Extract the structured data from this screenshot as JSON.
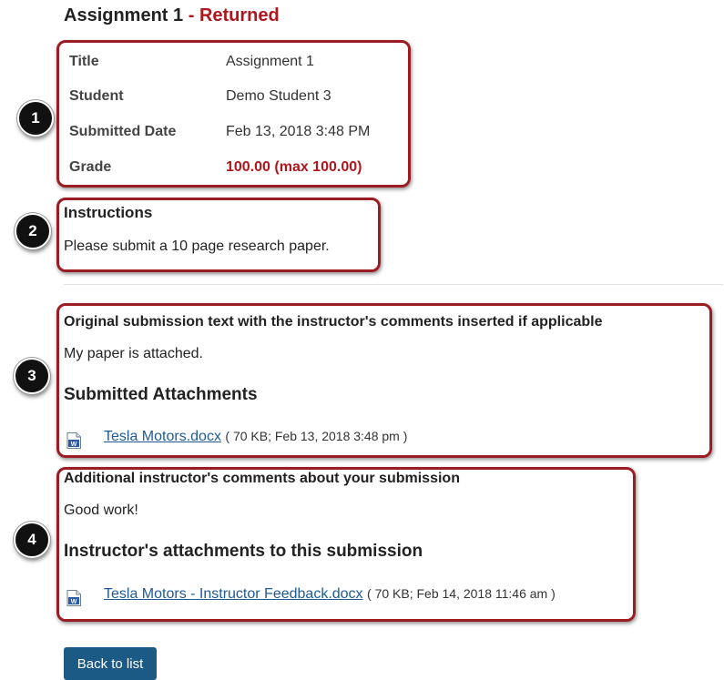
{
  "header": {
    "title": "Assignment 1",
    "separator": " - ",
    "status": "Returned"
  },
  "details": {
    "title_label": "Title",
    "title_value": "Assignment 1",
    "student_label": "Student",
    "student_value": "Demo Student 3",
    "submitted_label": "Submitted Date",
    "submitted_value": "Feb 13, 2018 3:48 PM",
    "grade_label": "Grade",
    "grade_value": "100.00 (max 100.00)"
  },
  "instructions": {
    "heading": "Instructions",
    "text": "Please submit a 10 page research paper."
  },
  "submission": {
    "heading": "Original submission text with the instructor's comments inserted if applicable",
    "text": "My paper is attached.",
    "attachments_heading": "Submitted Attachments",
    "file_name": "Tesla Motors.docx",
    "file_meta": "( 70 KB; Feb 13, 2018 3:48 pm )"
  },
  "feedback": {
    "heading": "Additional instructor's comments about your submission",
    "text": "Good work!",
    "attachments_heading": "Instructor's attachments to this submission",
    "file_name": "Tesla Motors - Instructor Feedback.docx",
    "file_meta": "( 70 KB; Feb 14, 2018 11:46 am )"
  },
  "callouts": [
    "1",
    "2",
    "3",
    "4"
  ],
  "actions": {
    "back_label": "Back to list"
  },
  "colors": {
    "accent_red": "#b0161c",
    "highlight_border": "#9b1c22",
    "link": "#1f5a94",
    "button": "#1c5a86"
  },
  "icons": {
    "file": "word-document-icon"
  }
}
